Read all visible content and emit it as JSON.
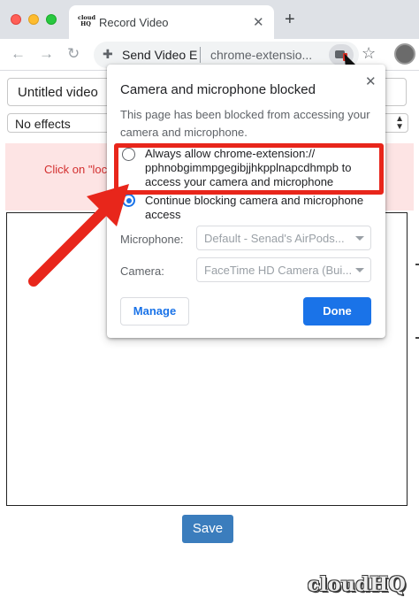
{
  "browser": {
    "tab": {
      "title": "Record Video",
      "favicon_text": "cloud HQ"
    },
    "omnibox": {
      "page_name": "Send Video E",
      "url": "chrome-extensio..."
    }
  },
  "page": {
    "title_input_value": "Untitled video",
    "effects_selected": "No effects",
    "alert_text": "Click on \"loc",
    "save_label": "Save"
  },
  "permission_popup": {
    "title": "Camera and microphone blocked",
    "description": "This page has been blocked from accessing your camera and microphone.",
    "options": [
      {
        "line1": "Always allow chrome-extension://",
        "line2": "pphnobgimmpgegibjjhkpplnapcdhmpb to",
        "line3": "access your camera and microphone",
        "selected": false
      },
      {
        "line1": "Continue blocking camera and microphone",
        "line2": "access",
        "selected": true
      }
    ],
    "microphone_label": "Microphone:",
    "microphone_value": "Default - Senad's AirPods...",
    "camera_label": "Camera:",
    "camera_value": "FaceTime HD Camera (Bui...",
    "manage_label": "Manage",
    "done_label": "Done"
  },
  "watermark": "cloudHQ",
  "colors": {
    "highlight": "#e8261b",
    "done_button": "#1a73e8",
    "save_button": "#3b7dbd",
    "alert_background": "#fde4e4"
  }
}
